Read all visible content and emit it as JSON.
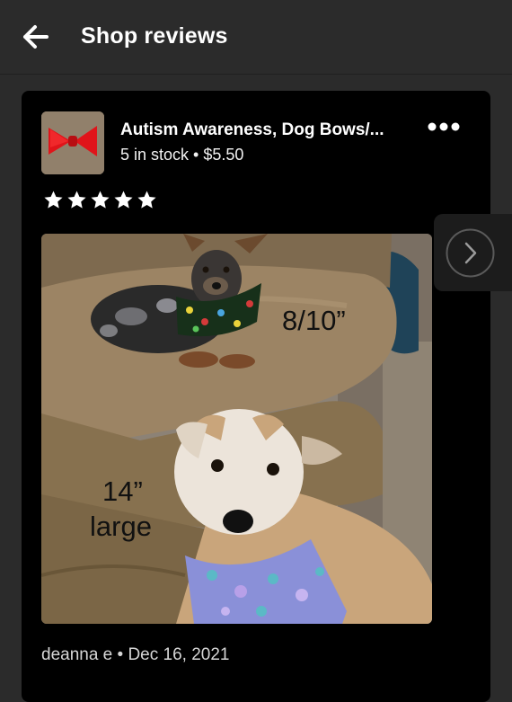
{
  "header": {
    "title": "Shop reviews",
    "back_icon": "arrow-left-icon"
  },
  "review": {
    "product_title": "Autism Awareness, Dog Bows/...",
    "stock_price": "5 in stock • $5.50",
    "rating": 5,
    "rating_max": 5,
    "photo_labels": {
      "small_size": "8/10”",
      "large_size": "14”",
      "large_word": "large"
    },
    "reviewer_line": "deanna e • Dec 16, 2021",
    "more_icon": "ellipsis-icon",
    "next_icon": "chevron-right-icon"
  },
  "colors": {
    "background": "#2b2b2b",
    "card": "#000000",
    "bow": "#e0141a",
    "scarf_small": "#1c3a1c",
    "scarf_large": "#8a90d8"
  }
}
